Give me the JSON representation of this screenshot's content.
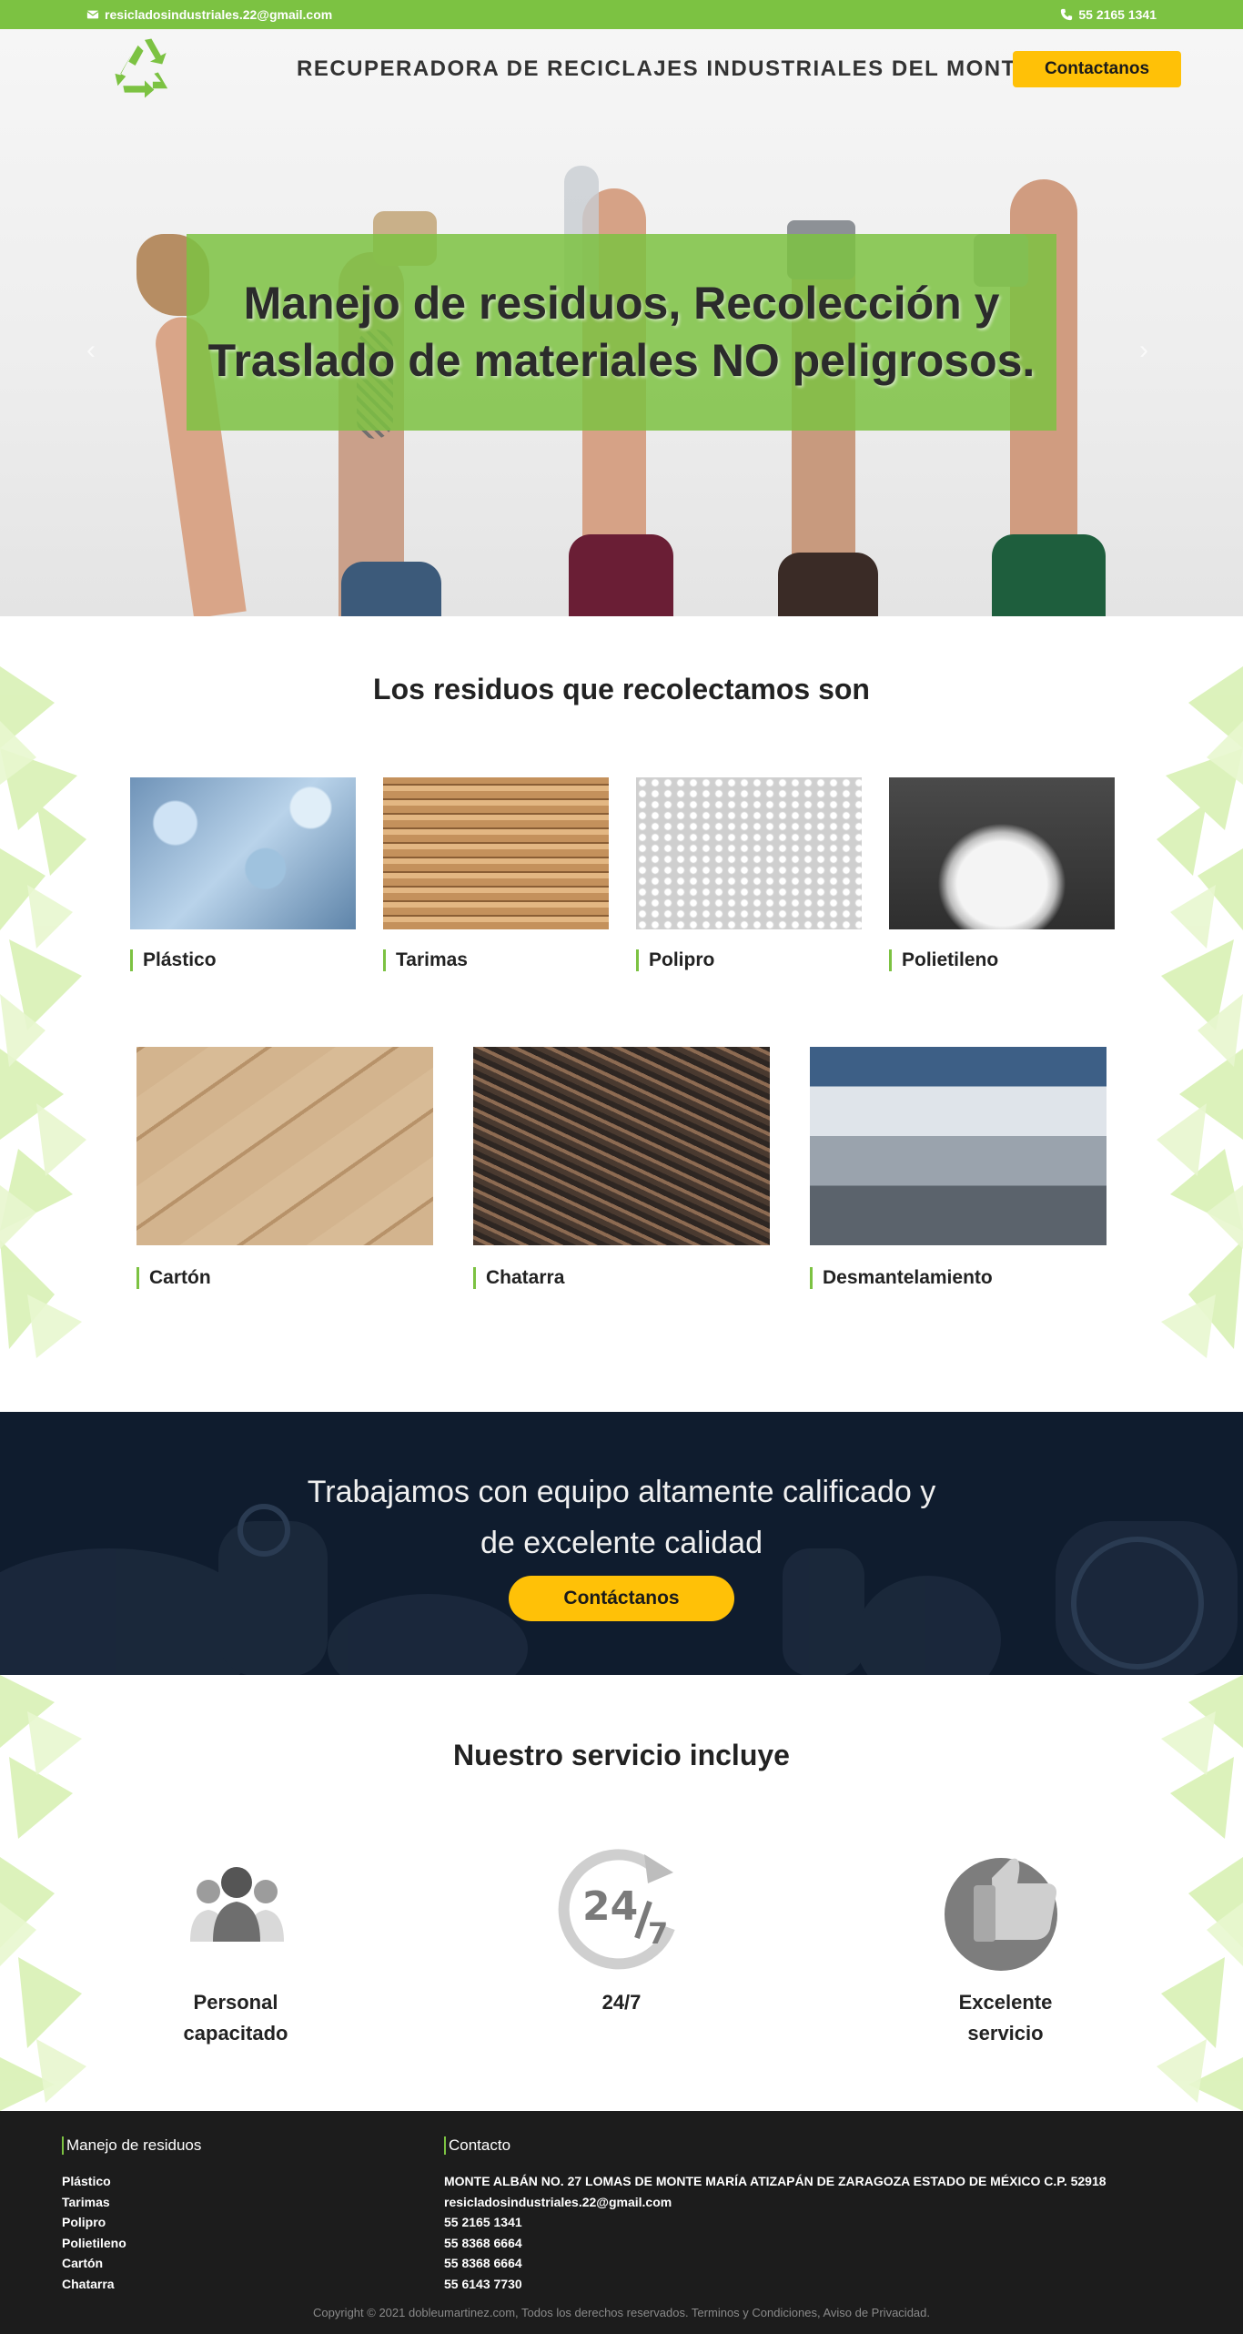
{
  "topbar": {
    "email": "resicladosindustriales.22@gmail.com",
    "phone": "55 2165 1341"
  },
  "header": {
    "brand": "RECUPERADORA DE RECICLAJES INDUSTRIALES DEL MONTE",
    "cta_label": "Contactanos"
  },
  "hero": {
    "headline": "Manejo de residuos, Recolección y Traslado de materiales NO peligrosos.",
    "prev_arrow": "‹",
    "next_arrow": "›"
  },
  "residuos": {
    "title": "Los residuos que recolectamos son",
    "row1": [
      {
        "label": "Plástico"
      },
      {
        "label": "Tarimas"
      },
      {
        "label": "Polipro"
      },
      {
        "label": "Polietileno"
      }
    ],
    "row2": [
      {
        "label": "Cartón"
      },
      {
        "label": "Chatarra"
      },
      {
        "label": "Desmantelamiento"
      }
    ]
  },
  "band": {
    "line1": "Trabajamos con equipo altamente calificado y",
    "line2": "de excelente calidad",
    "cta_label": "Contáctanos"
  },
  "servicio": {
    "title": "Nuestro servicio incluye",
    "items": [
      {
        "line1": "Personal",
        "line2": "capacitado"
      },
      {
        "line1": "24/7",
        "line2": ""
      },
      {
        "line1": "Excelente",
        "line2": "servicio"
      }
    ]
  },
  "footer": {
    "col1_title": "Manejo de residuos",
    "col1_items": [
      "Plástico",
      "Tarimas",
      "Polipro",
      "Polietileno",
      "Cartón",
      "Chatarra"
    ],
    "col2_title": "Contacto",
    "col2_items": [
      "MONTE ALBÁN NO. 27 LOMAS DE MONTE MARÍA ATIZAPÁN DE ZARAGOZA ESTADO DE MÉXICO C.P. 52918",
      "resicladosindustriales.22@gmail.com",
      "55 2165 1341",
      "55 8368 6664",
      "55 8368 6664",
      "55 6143 7730"
    ],
    "copyright": "Copyright © 2021 dobleumartinez.com, Todos los derechos reservados. Terminos y Condiciones, Aviso de Privacidad."
  },
  "colors": {
    "accent_green": "#7cc242",
    "cta_yellow": "#ffc107",
    "band_navy": "#0f1c2e",
    "footer_dark": "#1c1c1c"
  }
}
